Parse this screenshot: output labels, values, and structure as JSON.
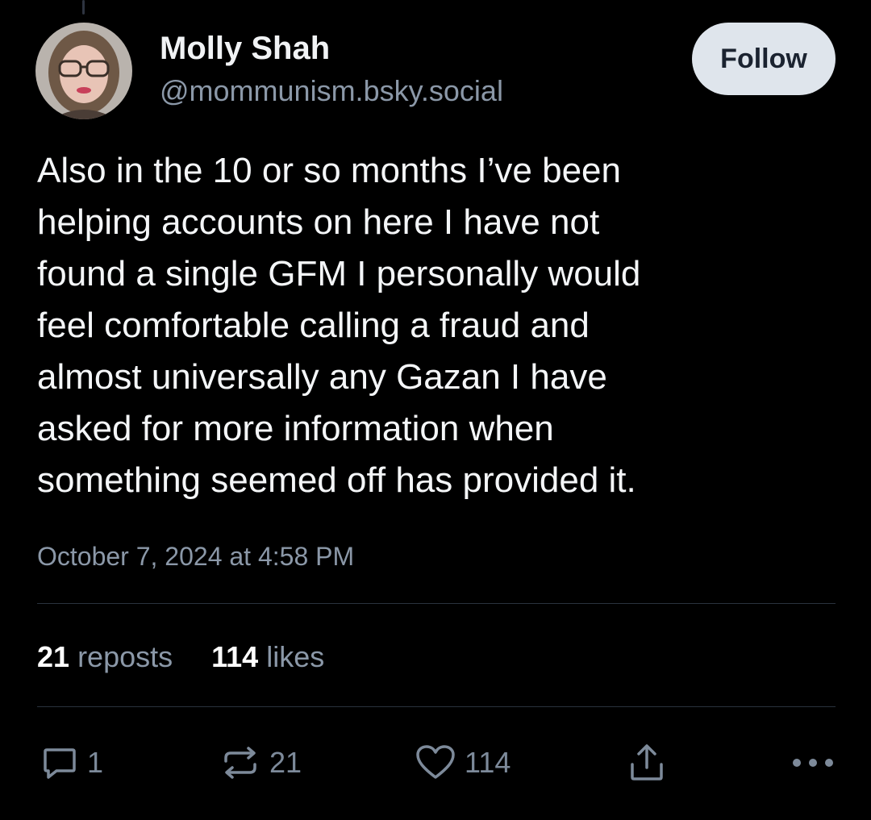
{
  "author": {
    "display_name": "Molly Shah",
    "handle": "@mommunism.bsky.social",
    "avatar_icon": "avatar-portrait-icon"
  },
  "follow_label": "Follow",
  "post": {
    "text": "Also in the 10 or so months I’ve been\nhelping accounts on here I have not\nfound a single GFM I personally would\nfeel comfortable calling a fraud and\nalmost universally any Gazan I have\nasked for more information when\nsomething seemed off has provided it.",
    "timestamp": "October 7, 2024 at 4:58 PM"
  },
  "stats": {
    "reposts_count": "21",
    "reposts_label": "reposts",
    "likes_count": "114",
    "likes_label": "likes"
  },
  "actions": {
    "reply_icon": "reply-icon",
    "reply_count": "1",
    "repost_icon": "repost-icon",
    "repost_count": "21",
    "like_icon": "heart-icon",
    "like_count": "114",
    "share_icon": "share-icon",
    "more_icon": "more-dots-icon"
  },
  "colors": {
    "background": "#000000",
    "text_primary": "#f4f6f8",
    "text_muted": "#8b98a8",
    "icon_muted": "#7d8a9a",
    "follow_bg": "#dfe5ec",
    "divider": "#2a323d"
  }
}
